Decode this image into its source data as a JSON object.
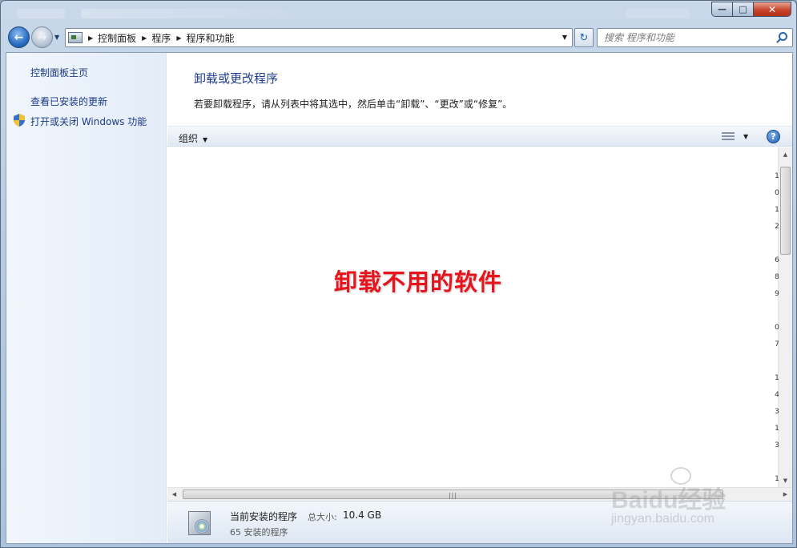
{
  "window": {
    "minimize_glyph": "—",
    "maximize_glyph": "□",
    "close_glyph": "✕"
  },
  "navbar": {
    "breadcrumbs": [
      "控制面板",
      "程序",
      "程序和功能"
    ],
    "search_placeholder": "搜索 程序和功能",
    "refresh_glyph": "↻"
  },
  "sidebar": {
    "items": [
      {
        "label": "控制面板主页",
        "icon": null
      },
      {
        "label": "查看已安装的更新",
        "icon": null
      },
      {
        "label": "打开或关闭 Windows 功能",
        "icon": "shield-icon"
      }
    ]
  },
  "main": {
    "title": "卸载或更改程序",
    "description": "若要卸载程序，请从列表中将其选中，然后单击“卸载”、“更改”或“修复”。"
  },
  "toolbar": {
    "organize_label": "组织",
    "help_glyph": "?"
  },
  "overlay": {
    "text": "卸载不用的软件",
    "color": "#e8141d"
  },
  "scrollbar_marks": [
    "1",
    "0",
    "1",
    "2",
    "",
    "6",
    "8",
    "9",
    "",
    "0",
    "7",
    "",
    "1",
    "4",
    "3",
    "1",
    "3",
    "",
    "1"
  ],
  "details": {
    "title": "当前安装的程序",
    "size_label": "总大小:",
    "size_value": "10.4 GB",
    "count_text": "65 安装的程序"
  },
  "watermark": {
    "brand": "Baidu经验",
    "url": "jingyan.baidu.com"
  },
  "colors": {
    "link": "#1a3a86",
    "title": "#1e3c8c",
    "accent": "#2a63ad"
  }
}
